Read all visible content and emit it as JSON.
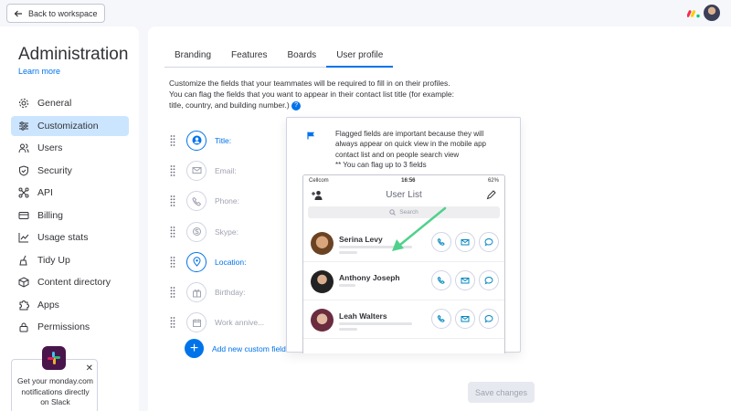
{
  "topbar": {
    "back_label": "Back to workspace"
  },
  "sidebar": {
    "title": "Administration",
    "learn_more": "Learn more",
    "items": [
      {
        "label": "General",
        "icon": "gear-icon"
      },
      {
        "label": "Customization",
        "icon": "sliders-icon",
        "active": true
      },
      {
        "label": "Users",
        "icon": "users-icon"
      },
      {
        "label": "Security",
        "icon": "shield-icon"
      },
      {
        "label": "API",
        "icon": "api-icon"
      },
      {
        "label": "Billing",
        "icon": "billing-icon"
      },
      {
        "label": "Usage stats",
        "icon": "chart-icon"
      },
      {
        "label": "Tidy Up",
        "icon": "broom-icon"
      },
      {
        "label": "Content directory",
        "icon": "box-icon"
      },
      {
        "label": "Apps",
        "icon": "puzzle-icon"
      },
      {
        "label": "Permissions",
        "icon": "lock-icon"
      }
    ],
    "notification": {
      "text": "Get your monday.com notifications directly on Slack"
    }
  },
  "tabs": [
    "Branding",
    "Features",
    "Boards",
    "User profile"
  ],
  "active_tab": "User profile",
  "description": {
    "line1": "Customize the fields that your teammates will be required to fill in on their profiles.",
    "line2": "You can flag the fields that you want to appear in their contact list title (for example:",
    "line3": "title, country, and building number.)"
  },
  "fields": [
    {
      "label": "Title:",
      "icon": "person-icon",
      "flagged": true
    },
    {
      "label": "Email:",
      "icon": "email-icon",
      "flagged": false
    },
    {
      "label": "Phone:",
      "icon": "phone-icon",
      "flagged": false
    },
    {
      "label": "Skype:",
      "icon": "skype-icon",
      "flagged": false
    },
    {
      "label": "Location:",
      "icon": "location-icon",
      "flagged": true
    },
    {
      "label": "Birthday:",
      "icon": "gift-icon",
      "flagged": false
    },
    {
      "label": "Work annive...",
      "icon": "calendar-icon",
      "flagged": false
    }
  ],
  "add_field_label": "Add new custom field",
  "save_label": "Save changes",
  "tooltip": {
    "line1": "Flagged fields are important because they will",
    "line2": "always appear on quick view in the mobile app",
    "line3": "contact list and on people search view",
    "line4": "** You can flag up to 3 fields",
    "phone": {
      "carrier": "Cellcom",
      "time": "16:56",
      "battery": "62%",
      "title": "User List",
      "search_placeholder": "Search",
      "contacts": [
        {
          "name": "Serina Levy"
        },
        {
          "name": "Anthony Joseph"
        },
        {
          "name": "Leah Walters"
        }
      ]
    }
  },
  "colors": {
    "accent": "#0073ea",
    "active_bg": "#cce5ff",
    "page_bg": "#f6f7fb",
    "arrow": "#4fd18b"
  }
}
